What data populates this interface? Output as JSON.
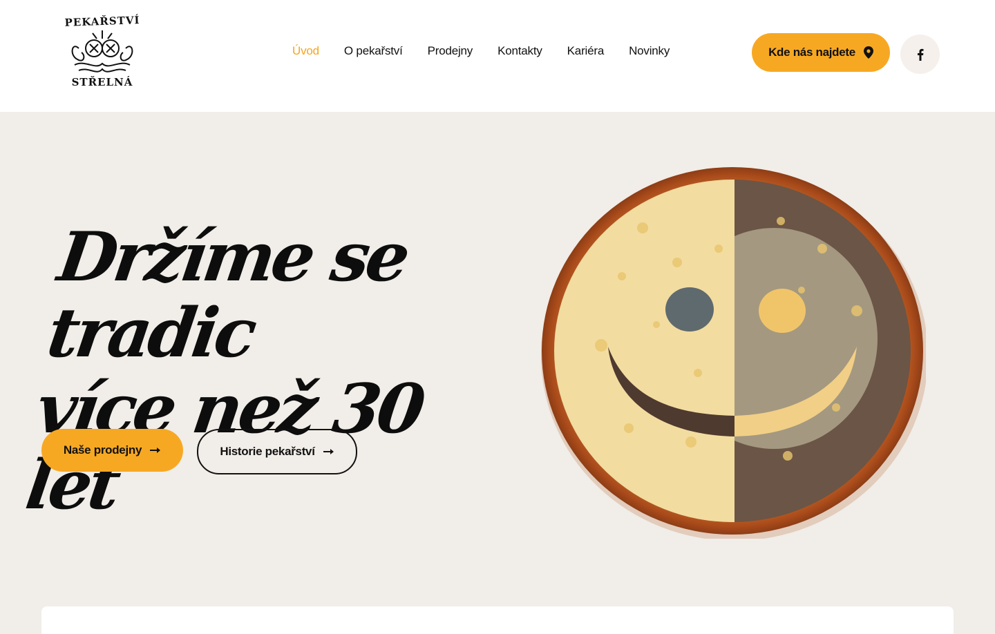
{
  "logo": {
    "text_top": "PEKAŘSTVÍ",
    "text_bottom": "STŘELNÁ"
  },
  "nav": {
    "items": [
      {
        "label": "Úvod",
        "active": true
      },
      {
        "label": "O pekařství",
        "active": false
      },
      {
        "label": "Prodejny",
        "active": false
      },
      {
        "label": "Kontakty",
        "active": false
      },
      {
        "label": "Kariéra",
        "active": false
      },
      {
        "label": "Novinky",
        "active": false
      }
    ]
  },
  "header_actions": {
    "find_us_label": "Kde nás najdete",
    "find_us_icon": "map-pin-icon",
    "social_icon": "facebook-icon"
  },
  "hero": {
    "title_line1": "Držíme se tradic",
    "title_line2": "více než 30 let",
    "primary_button": "Naše prodejny",
    "secondary_button": "Historie pekařství",
    "image": "kolac-smiley-image"
  },
  "colors": {
    "accent": "#f7a823",
    "active_nav": "#f4a51c",
    "background": "#f1ede8",
    "text": "#111111"
  }
}
